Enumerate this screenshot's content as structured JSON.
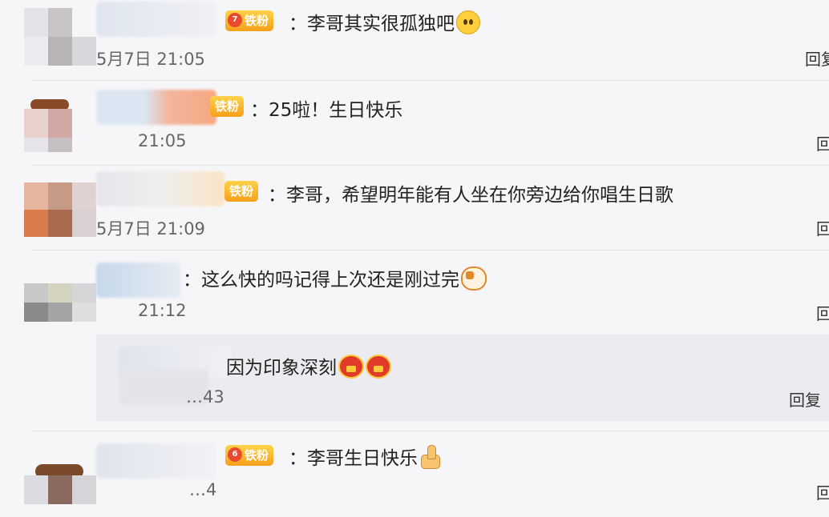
{
  "comments": [
    {
      "badge": "铁粉",
      "badge_level": "7",
      "text": "李哥其实很孤独吧",
      "emoji": "pleading-face",
      "time": "5月7日 21:05",
      "reply": "回复"
    },
    {
      "badge": "铁粉",
      "badge_level": "",
      "text": "25啦！生日快乐",
      "emoji": "",
      "time": "21:05",
      "reply": "回复"
    },
    {
      "badge": "铁粉",
      "badge_level": "",
      "text": "李哥，希望明年能有人坐在你旁边给你唱生日歌",
      "emoji": "",
      "time": "5月7日 21:09",
      "reply": "回复"
    },
    {
      "badge": "",
      "badge_level": "",
      "text": "这么快的吗记得上次还是刚过完",
      "emoji": "cat-face",
      "time": "21:12",
      "reply": "回复"
    },
    {
      "badge": "铁粉",
      "badge_level": "6",
      "text": "李哥生日快乐",
      "emoji": "thumbs-up",
      "time": "…4",
      "reply": "回复"
    }
  ],
  "subreply": {
    "text": "因为印象深刻",
    "emoji": "money-face",
    "time": "…43",
    "reply": "回复"
  },
  "colors": {
    "background": "#f6f6f9",
    "badge": "#f6a019",
    "subreply_bg": "#ececf0"
  }
}
